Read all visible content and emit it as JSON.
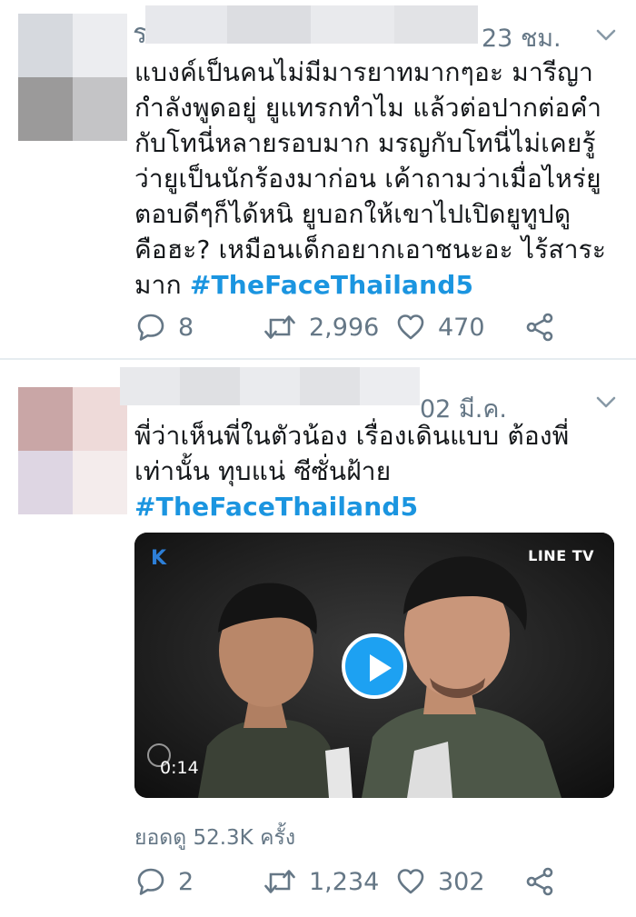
{
  "colors": {
    "accent": "#1da1f2",
    "hashtag": "#1b95e0",
    "muted": "#657786",
    "text": "#14171a"
  },
  "tweets": [
    {
      "name_stub": "ร",
      "timestamp": "23 ชม.",
      "text": "แบงค์เป็นคนไม่มีมารยาทมากๆอะ มารีญา\nกำลังพูดอยู่ ยูแทรกทำไม แล้วต่อปากต่อคำ\nกับโทนี่หลายรอบมาก มรญกับโทนี่ไม่เคยรู้\nว่ายูเป็นนักร้องมาก่อน เค้าถามว่าเมื่อไหร่ยู\nตอบดีๆก็ได้หนิ ยูบอกให้เขาไปเปิดยูทูปดู\nคือฮะ? เหมือนเด็กอยากเอาชนะอะ ไร้สาระ\nมาก ",
      "hashtag": "#TheFaceThailand5",
      "actions": {
        "replies": "8",
        "retweets": "2,996",
        "likes": "470"
      }
    },
    {
      "timestamp": "02 มี.ค.",
      "text": "พี่ว่าเห็นพี่ในตัวน้อง เรื่องเดินแบบ ต้องพี่\nเท่านั้น ทุบแน่ ซีซั่นฝ้าย",
      "hashtag": "#TheFaceThailand5",
      "video": {
        "channel_logo": "K",
        "watermark": "LINE TV",
        "duration": "0:14"
      },
      "views": "ยอดดู 52.3K ครั้ง",
      "actions": {
        "replies": "2",
        "retweets": "1,234",
        "likes": "302"
      }
    }
  ],
  "icons": {
    "reply": "speech-bubble-icon",
    "retweet": "retweet-arrows-icon",
    "like": "heart-outline-icon",
    "share": "share-nodes-icon",
    "caret": "chevron-down-icon",
    "play": "play-icon"
  }
}
